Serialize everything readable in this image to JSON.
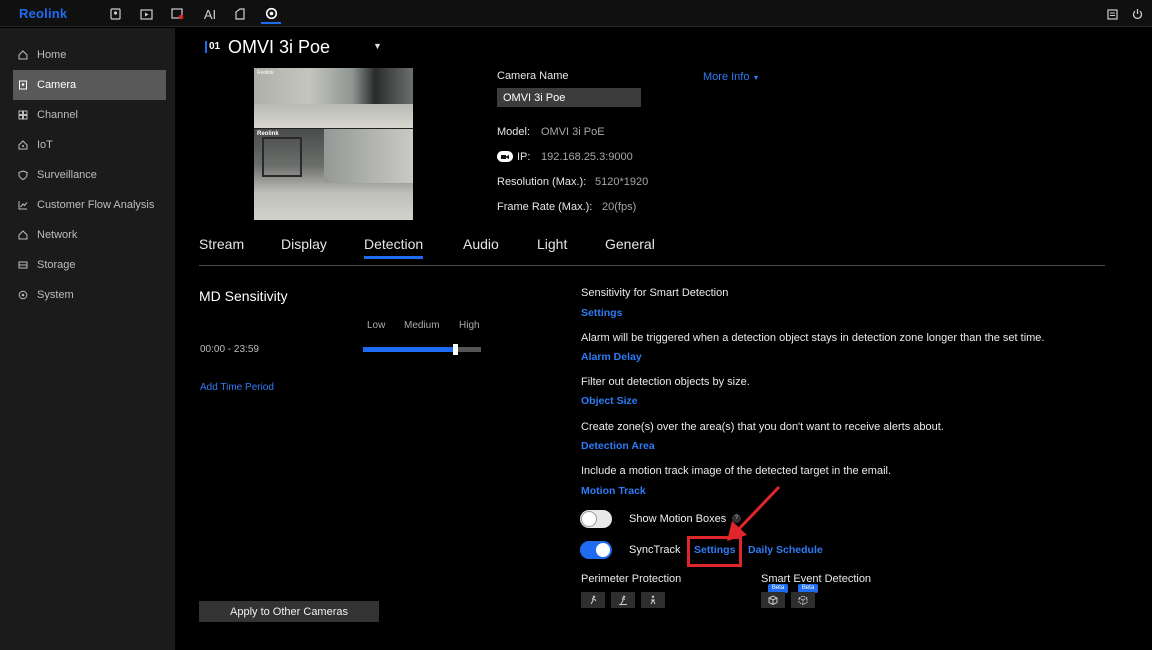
{
  "brand": {
    "logo": "Reolink"
  },
  "topbar": {
    "icons": [
      "camera-view-icon",
      "playback-icon",
      "alarm-icon",
      "ai-icon",
      "clip-icon",
      "settings-icon",
      "message-icon",
      "power-icon"
    ],
    "ai_label": "AI",
    "active": "settings-icon"
  },
  "sidebar": {
    "items": [
      {
        "label": "Home",
        "icon": "home-icon",
        "active": false
      },
      {
        "label": "Camera",
        "icon": "camera-icon",
        "active": true
      },
      {
        "label": "Channel",
        "icon": "channel-icon",
        "active": false
      },
      {
        "label": "IoT",
        "icon": "iot-icon",
        "active": false
      },
      {
        "label": "Surveillance",
        "icon": "shield-icon",
        "active": false
      },
      {
        "label": "Customer Flow Analysis",
        "icon": "chart-icon",
        "active": false
      },
      {
        "label": "Network",
        "icon": "network-icon",
        "active": false
      },
      {
        "label": "Storage",
        "icon": "storage-icon",
        "active": false
      },
      {
        "label": "System",
        "icon": "system-icon",
        "active": false
      }
    ]
  },
  "camera": {
    "channel": "01",
    "title": "OMVI 3i Poe",
    "name_label": "Camera Name",
    "name_value": "OMVI 3i Poe",
    "more_info": "More Info",
    "model_label": "Model:",
    "model_value": "OMVI 3i PoE",
    "ip_label": "IP:",
    "ip_value": "192.168.25.3:9000",
    "resolution_label": "Resolution (Max.):",
    "resolution_value": "5120*1920",
    "framerate_label": "Frame Rate (Max.):",
    "framerate_value": "20(fps)",
    "preview_brand_top": "Reolink",
    "preview_brand_bottom": "Reolink"
  },
  "tabs": [
    {
      "label": "Stream",
      "active": false
    },
    {
      "label": "Display",
      "active": false
    },
    {
      "label": "Detection",
      "active": true
    },
    {
      "label": "Audio",
      "active": false
    },
    {
      "label": "Light",
      "active": false
    },
    {
      "label": "General",
      "active": false
    }
  ],
  "md": {
    "title": "MD Sensitivity",
    "levels": [
      "Low",
      "Medium",
      "High"
    ],
    "time_range": "00:00 - 23:59",
    "sensitivity_fraction": 0.8,
    "add_period": "Add Time Period",
    "apply": "Apply to Other Cameras"
  },
  "detection": {
    "smart_title": "Sensitivity for Smart Detection",
    "smart_link": "Settings",
    "alarm_desc": "Alarm will be triggered when a detection object stays in detection zone longer than the set time.",
    "alarm_link": "Alarm Delay",
    "size_desc": "Filter out detection objects by size.",
    "size_link": "Object Size",
    "zone_desc": "Create zone(s) over the area(s) that you don't want to receive alerts about.",
    "zone_link": "Detection Area",
    "track_desc": "Include a motion track image of the detected target in the email.",
    "track_link": "Motion Track",
    "motion_boxes_label": "Show Motion Boxes",
    "motion_boxes_on": false,
    "help": "?",
    "synctrack_label": "SyncTrack",
    "synctrack_on": true,
    "synctrack_settings": "Settings",
    "daily_schedule": "Daily Schedule",
    "perimeter_label": "Perimeter Protection",
    "smart_event_label": "Smart Event Detection",
    "beta": "Beta"
  },
  "colors": {
    "accent": "#1e6cf2",
    "highlight": "#e0252b",
    "sidebar_active": "#595959"
  }
}
